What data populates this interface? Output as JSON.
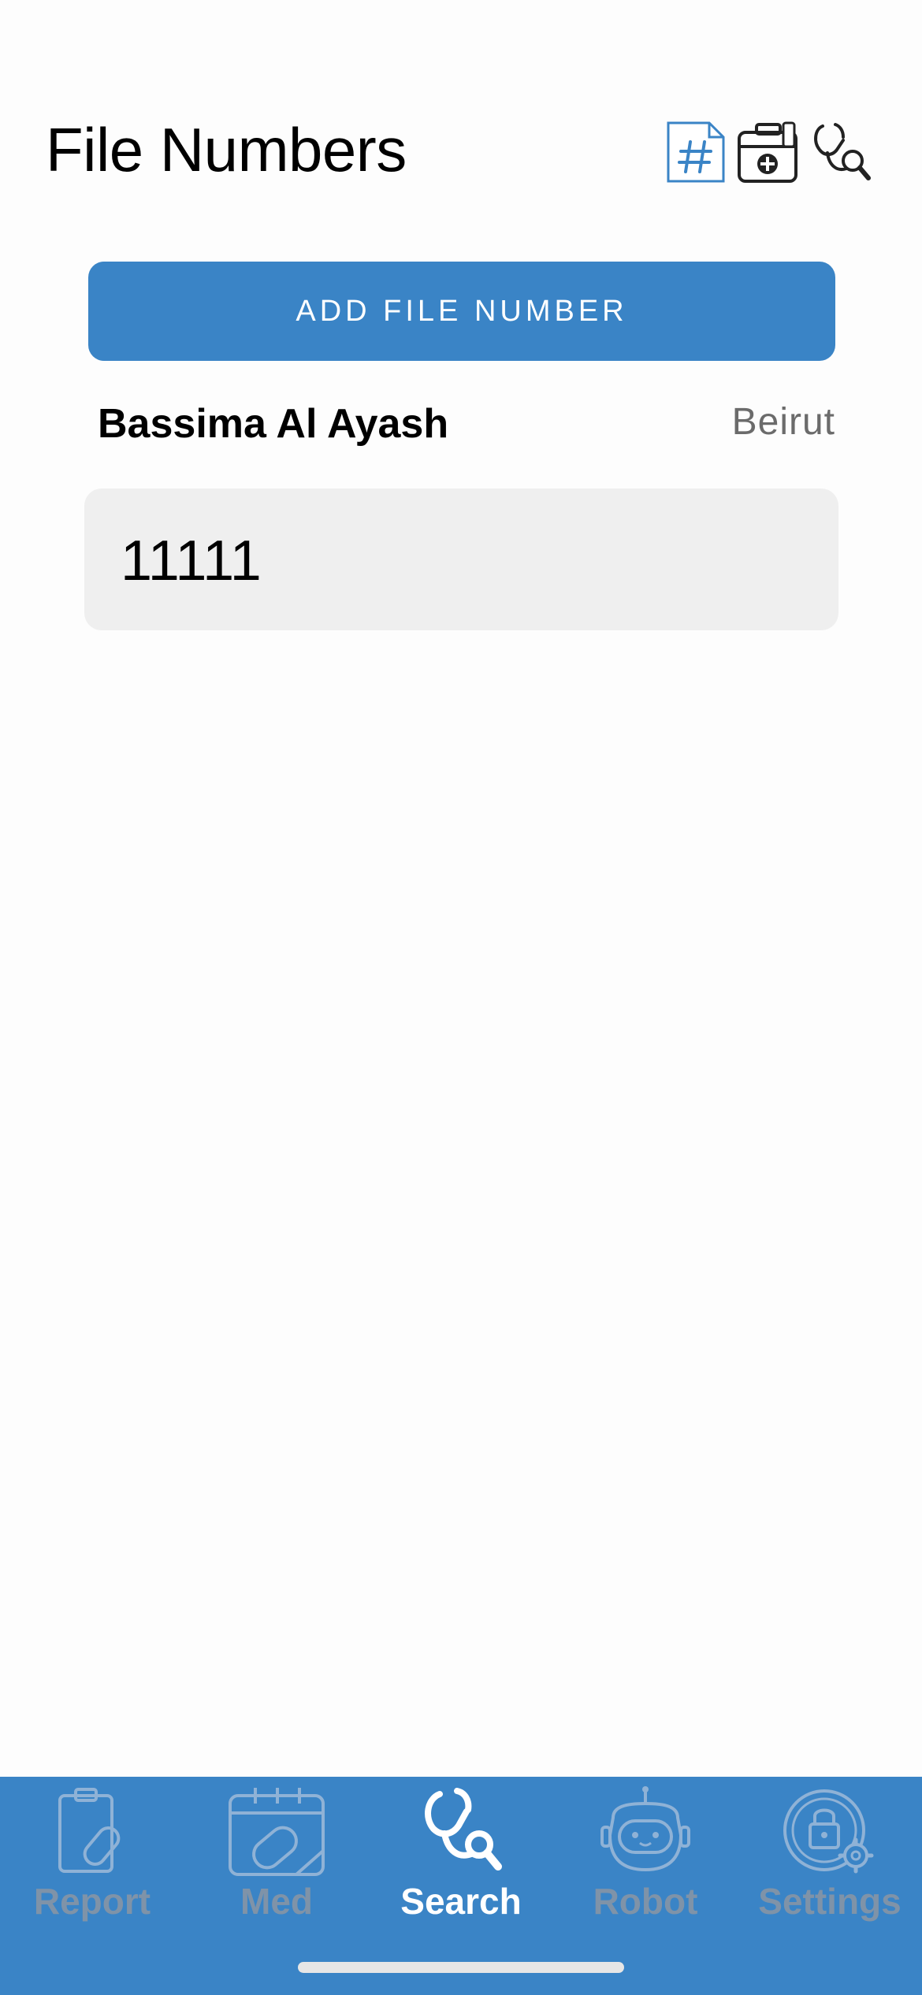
{
  "header": {
    "title": "File Numbers",
    "icons": [
      "hash-document-icon",
      "first-aid-kit-icon",
      "stethoscope-search-icon"
    ]
  },
  "actions": {
    "add_label": "ADD FILE NUMBER"
  },
  "patient": {
    "name": "Bassima Al Ayash",
    "city": "Beirut"
  },
  "file_numbers": [
    "11111"
  ],
  "tabs": [
    {
      "label": "Report",
      "icon": "clipboard-pill-icon",
      "active": false
    },
    {
      "label": "Med",
      "icon": "calendar-pill-icon",
      "active": false
    },
    {
      "label": "Search",
      "icon": "stethoscope-search-icon",
      "active": true
    },
    {
      "label": "Robot",
      "icon": "robot-icon",
      "active": false
    },
    {
      "label": "Settings",
      "icon": "lock-gear-icon",
      "active": false
    }
  ],
  "colors": {
    "accent": "#3a84c6",
    "inactive_tab": "#7f93a8",
    "card_bg": "#efefef",
    "secondary_text": "#6b6b6b"
  }
}
